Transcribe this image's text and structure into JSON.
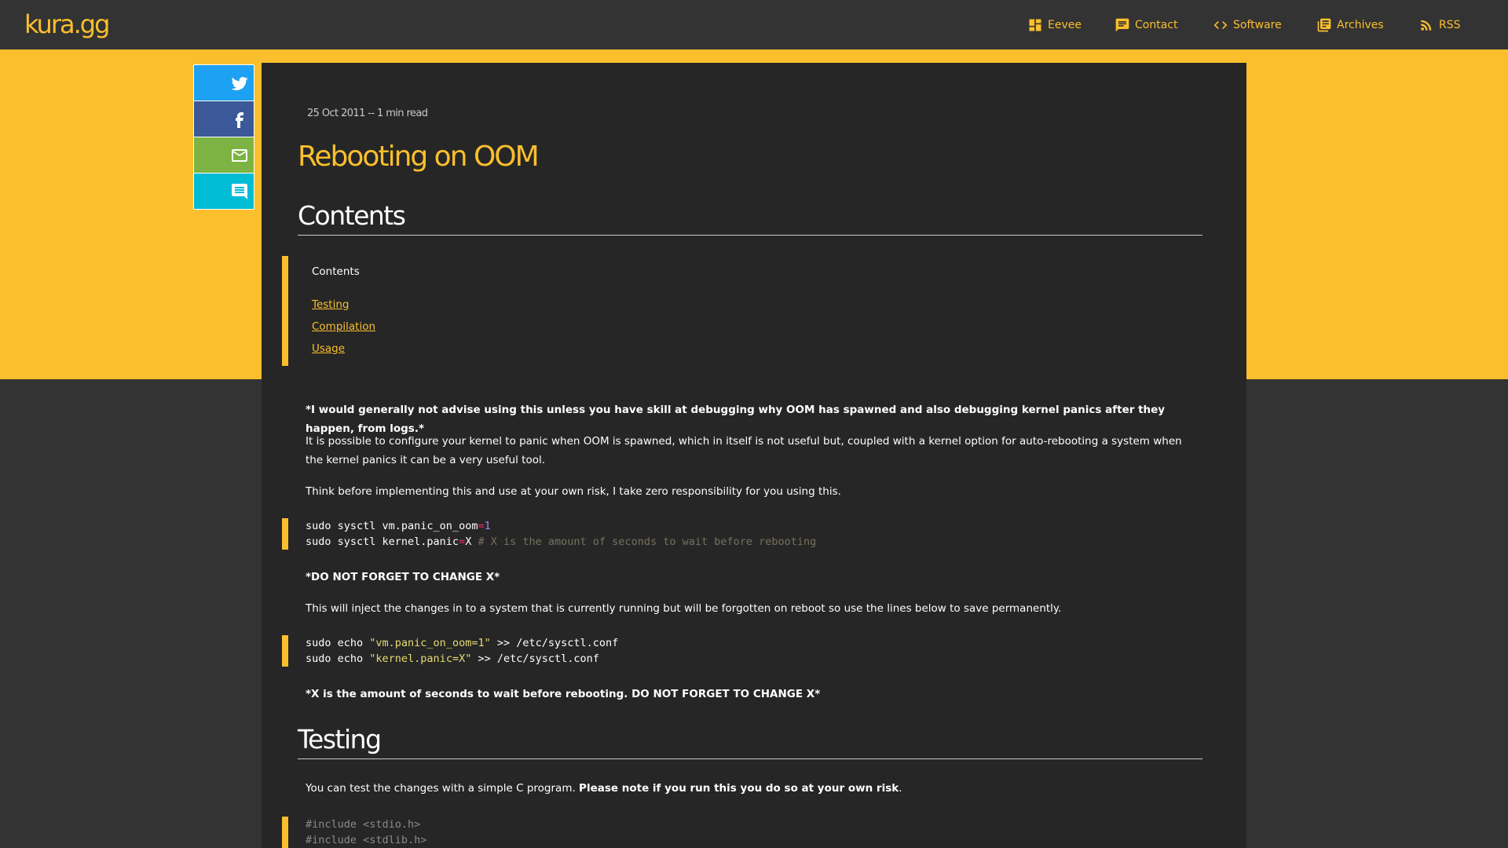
{
  "nav": {
    "brand": "kura.gg",
    "items": [
      {
        "label": "Eevee",
        "icon": "dashboard-icon"
      },
      {
        "label": "Contact",
        "icon": "chat-icon"
      },
      {
        "label": "Software",
        "icon": "code-icon"
      },
      {
        "label": "Archives",
        "icon": "library-icon"
      },
      {
        "label": "RSS",
        "icon": "rss-icon"
      }
    ]
  },
  "share": [
    {
      "name": "twitter",
      "icon": "twitter-icon",
      "color": "#1da1f2"
    },
    {
      "name": "facebook",
      "icon": "facebook-icon",
      "color": "#3b5998"
    },
    {
      "name": "email",
      "icon": "mail-icon",
      "color": "#7cb342"
    },
    {
      "name": "comment",
      "icon": "comment-icon",
      "color": "#00bcd4"
    }
  ],
  "post": {
    "meta": "25 Oct 2011 -- 1 min read",
    "title": "Rebooting on OOM",
    "contents_heading": "Contents",
    "toc": {
      "title": "Contents",
      "links": [
        "Testing",
        "Compilation",
        "Usage"
      ]
    },
    "warning": "*I would generally not advise using this unless you have skill at debugging why OOM has spawned and also debugging kernel panics after they happen, from logs.*",
    "intro": "It is possible to configure your kernel to panic when OOM is spawned, which in itself is not useful but, coupled with a kernel option for auto-rebooting a system when the kernel panics it can be a very useful tool.",
    "think": "Think before implementing this and use at your own risk, I take zero responsibility for you using this.",
    "code1": {
      "line1_cmd": "sudo sysctl vm.panic_on_oom",
      "line1_op": "=",
      "line1_val": "1",
      "line2_cmd": "sudo sysctl kernel.panic",
      "line2_op": "=",
      "line2_val": "X",
      "line2_comment": "# X is the amount of seconds to wait before rebooting"
    },
    "dont_forget": "*DO NOT FORGET TO CHANGE X*",
    "inject": "This will inject the changes in to a system that is currently running but will be forgotten on reboot so use the lines below to save permanently.",
    "code2": {
      "line1_pre": "sudo echo ",
      "line1_str": "\"vm.panic_on_oom=1\"",
      "line1_post": " >> /etc/sysctl.conf",
      "line2_pre": "sudo echo ",
      "line2_str": "\"kernel.panic=X\"",
      "line2_post": " >> /etc/sysctl.conf"
    },
    "x_note": "*X is the amount of seconds to wait before rebooting. DO NOT FORGET TO CHANGE X*",
    "testing_heading": "Testing",
    "testing_text": "You can test the changes with a simple C program. ",
    "testing_bold": "Please note if you run this you do so at your own risk",
    "testing_end": ".",
    "code3": {
      "line1": "#include <stdio.h>",
      "line2": "#include <stdlib.h>"
    }
  },
  "colors": {
    "accent": "#fbbf2d",
    "background": "#333333",
    "card": "#262626"
  }
}
